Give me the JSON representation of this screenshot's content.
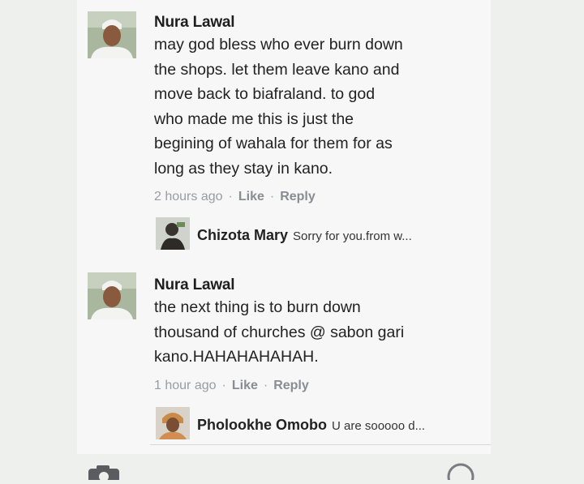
{
  "comments": [
    {
      "author": "Nura Lawal",
      "text": "may god bless who ever burn down\nthe shops. let them leave kano and\nmove back to biafraland. to god\nwho made me this is just the\nbegining of wahala for them for as\nlong as they stay in kano.",
      "time": "2 hours ago",
      "like_label": "Like",
      "reply_label": "Reply",
      "reply_preview": {
        "author": "Chizota Mary",
        "text": "Sorry for you.from w..."
      }
    },
    {
      "author": "Nura Lawal",
      "text": "the next thing is to burn down\nthousand of churches @ sabon gari\nkano.HAHAHAHAHAH.",
      "time": "1 hour ago",
      "like_label": "Like",
      "reply_label": "Reply",
      "reply_preview": {
        "author": "Pholookhe Omobo",
        "text": "U are sooooo d..."
      }
    }
  ],
  "icons": {
    "camera": "camera-icon",
    "emoji": "emoji-icon"
  },
  "colors": {
    "background": "#eef0ee",
    "text": "#222222",
    "meta": "#8d8f95"
  }
}
